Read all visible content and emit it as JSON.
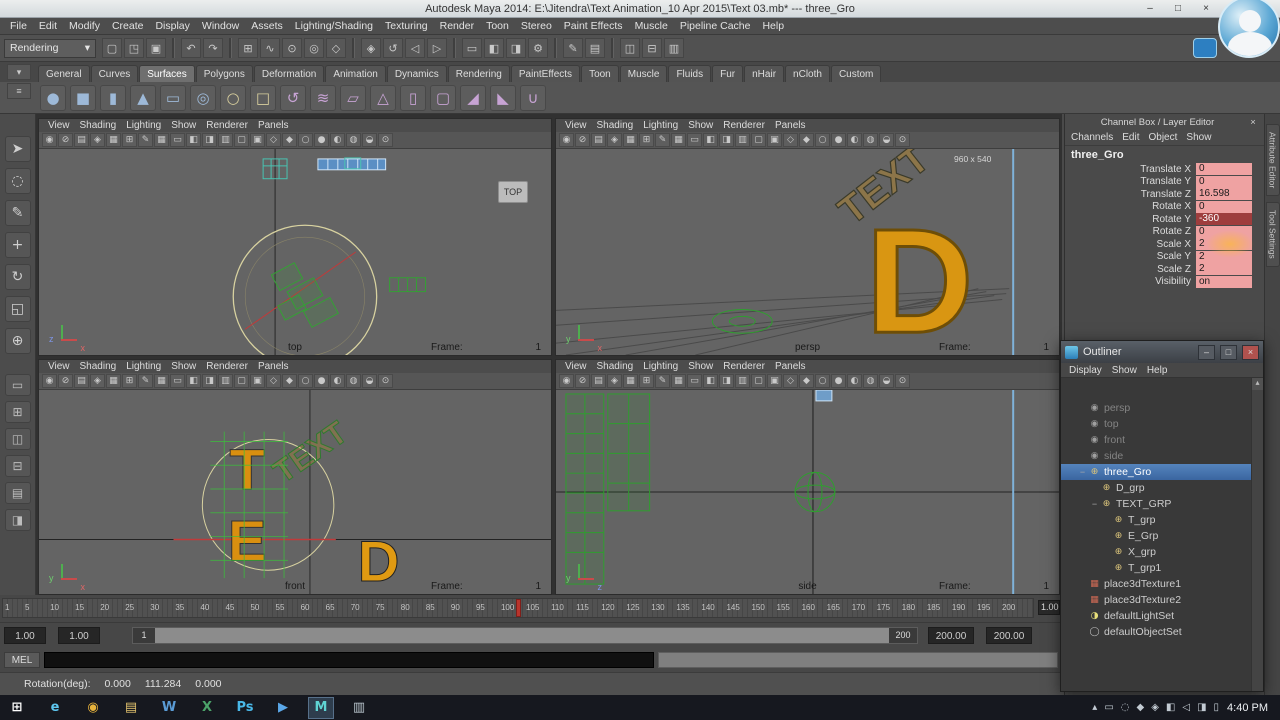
{
  "window": {
    "title": "Autodesk Maya 2014: E:\\Jitendra\\Text Animation_10 Apr 2015\\Text 03.mb*  ---  three_Gro",
    "minimize": "–",
    "maximize": "□",
    "close": "×"
  },
  "menu_bar": [
    "File",
    "Edit",
    "Modify",
    "Create",
    "Display",
    "Window",
    "Assets",
    "Lighting/Shading",
    "Texturing",
    "Render",
    "Toon",
    "Stereo",
    "Paint Effects",
    "Muscle",
    "Pipeline Cache",
    "Help"
  ],
  "status_line": {
    "menu_set": "Rendering",
    "caret": "▾",
    "icons": [
      {
        "name": "new-scene",
        "glyph": "▢"
      },
      {
        "name": "open-scene",
        "glyph": "◳"
      },
      {
        "name": "save-scene",
        "glyph": "▣"
      },
      {
        "name": "undo",
        "glyph": "↶"
      },
      {
        "name": "redo",
        "glyph": "↷"
      },
      {
        "name": "snap-to-grid",
        "glyph": "⊞"
      },
      {
        "name": "snap-to-curve",
        "glyph": "∿"
      },
      {
        "name": "snap-to-point",
        "glyph": "⊙"
      },
      {
        "name": "snap-to-projected-center",
        "glyph": "◎"
      },
      {
        "name": "snap-to-view-plane",
        "glyph": "◇"
      },
      {
        "name": "make-live",
        "glyph": "◈"
      },
      {
        "name": "construction-history",
        "glyph": "↺"
      },
      {
        "name": "list-input-connections",
        "glyph": "◁"
      },
      {
        "name": "list-output-connections",
        "glyph": "▷"
      },
      {
        "name": "open-render-view",
        "glyph": "▭"
      },
      {
        "name": "render-current-frame",
        "glyph": "◧"
      },
      {
        "name": "ipr-render",
        "glyph": "◨"
      },
      {
        "name": "render-settings",
        "glyph": "⚙"
      },
      {
        "name": "paint-effects-panel",
        "glyph": "✎"
      },
      {
        "name": "hypershade-panel",
        "glyph": "▤"
      },
      {
        "name": "show-attribute-editor",
        "glyph": "◫"
      },
      {
        "name": "show-tool-settings",
        "glyph": "⊟"
      },
      {
        "name": "show-channel-box",
        "glyph": "▥"
      }
    ]
  },
  "shelf": {
    "active_tab": "Surfaces",
    "tabs": [
      "General",
      "Curves",
      "Surfaces",
      "Polygons",
      "Deformation",
      "Animation",
      "Dynamics",
      "Rendering",
      "PaintEffects",
      "Toon",
      "Muscle",
      "Fluids",
      "Fur",
      "nHair",
      "nCloth",
      "Custom"
    ],
    "menu_buttons": [
      {
        "name": "shelf-tab-switcher",
        "glyph": "▾"
      },
      {
        "name": "shelf-menu",
        "glyph": "≡"
      }
    ],
    "tools": [
      {
        "name": "nurbs-sphere",
        "glyph": "●",
        "color": "#9db9d8"
      },
      {
        "name": "nurbs-cube",
        "glyph": "■",
        "color": "#9db9d8"
      },
      {
        "name": "nurbs-cylinder",
        "glyph": "▮",
        "color": "#9db9d8"
      },
      {
        "name": "nurbs-cone",
        "glyph": "▲",
        "color": "#9db9d8"
      },
      {
        "name": "nurbs-plane",
        "glyph": "▭",
        "color": "#9db9d8"
      },
      {
        "name": "nurbs-torus",
        "glyph": "◎",
        "color": "#9db9d8"
      },
      {
        "name": "nurbs-circle",
        "glyph": "○",
        "color": "#d8cf9d"
      },
      {
        "name": "nurbs-square",
        "glyph": "□",
        "color": "#d8cf9d"
      },
      {
        "name": "revolve",
        "glyph": "↺",
        "color": "#c7a3d4"
      },
      {
        "name": "loft",
        "glyph": "≋",
        "color": "#c7a3d4"
      },
      {
        "name": "planar",
        "glyph": "▱",
        "color": "#c7a3d4"
      },
      {
        "name": "extrude",
        "glyph": "△",
        "color": "#c7a3d4"
      },
      {
        "name": "birail",
        "glyph": "▯",
        "color": "#c7a3d4"
      },
      {
        "name": "boundary",
        "glyph": "▢",
        "color": "#c7a3d4"
      },
      {
        "name": "bevel",
        "glyph": "◢",
        "color": "#c7a3d4"
      },
      {
        "name": "bevel-plus",
        "glyph": "◣",
        "color": "#c7a3d4"
      },
      {
        "name": "attach-surfaces",
        "glyph": "∪",
        "color": "#c7a3d4"
      }
    ]
  },
  "toolbox": {
    "tools": [
      {
        "name": "select-tool",
        "glyph": "➤"
      },
      {
        "name": "lasso-select-tool",
        "glyph": "◌"
      },
      {
        "name": "paint-selection-tool",
        "glyph": "✎"
      },
      {
        "name": "move-tool",
        "glyph": "+"
      },
      {
        "name": "rotate-tool",
        "glyph": "↻"
      },
      {
        "name": "scale-tool",
        "glyph": "◱"
      },
      {
        "name": "universal-manipulator-tool",
        "glyph": "⊕"
      }
    ],
    "layouts": [
      {
        "name": "single-pane-layout",
        "glyph": "▭"
      },
      {
        "name": "four-pane-layout",
        "glyph": "⊞"
      },
      {
        "name": "persp-outliner-layout",
        "glyph": "◫"
      },
      {
        "name": "persp-graph-layout",
        "glyph": "⊟"
      },
      {
        "name": "hypershade-persp-layout",
        "glyph": "▤"
      },
      {
        "name": "persp-persp-layout",
        "glyph": "◨"
      }
    ]
  },
  "viewports": {
    "menu": [
      "View",
      "Shading",
      "Lighting",
      "Show",
      "Renderer",
      "Panels"
    ],
    "frame_label": "Frame:",
    "toolbar_icons": [
      {
        "name": "select-camera",
        "glyph": "◉"
      },
      {
        "name": "lock-camera",
        "glyph": "⊘"
      },
      {
        "name": "camera-attributes",
        "glyph": "▤"
      },
      {
        "name": "bookmark-view",
        "glyph": "◈"
      },
      {
        "name": "image-plane",
        "glyph": "▦"
      },
      {
        "name": "two-d-pan-zoom",
        "glyph": "⊞"
      },
      {
        "name": "grease-pencil",
        "glyph": "✎"
      },
      {
        "name": "grid-toggle",
        "glyph": "▦"
      },
      {
        "name": "film-gate",
        "glyph": "▭"
      },
      {
        "name": "resolution-gate",
        "glyph": "◧"
      },
      {
        "name": "gate-mask",
        "glyph": "◨"
      },
      {
        "name": "field-chart",
        "glyph": "▥"
      },
      {
        "name": "safe-action",
        "glyph": "▢"
      },
      {
        "name": "safe-title",
        "glyph": "▣"
      },
      {
        "name": "frame-all",
        "glyph": "◇"
      },
      {
        "name": "frame-selection",
        "glyph": "◆"
      },
      {
        "name": "wireframe-display",
        "glyph": "○"
      },
      {
        "name": "shaded-display",
        "glyph": "●"
      },
      {
        "name": "textured-display",
        "glyph": "◐"
      },
      {
        "name": "use-default-material",
        "glyph": "◍"
      },
      {
        "name": "xray-display",
        "glyph": "◒"
      },
      {
        "name": "isolate-select",
        "glyph": "⊙"
      }
    ],
    "top": {
      "label": "top",
      "frame": "1",
      "overlay": "TOP",
      "axis_v": "z",
      "axis_h": "x"
    },
    "persp": {
      "label": "persp",
      "frame": "1",
      "resolution": "960 x 540",
      "scene_d": "D",
      "scene_text": "TEXT",
      "axis_v": "y",
      "axis_h": "x"
    },
    "front": {
      "label": "front",
      "frame": "1",
      "scene_t": "T",
      "scene_e": "E",
      "scene_d": "D",
      "scene_text": "TEXT",
      "axis_v": "y",
      "axis_h": "x"
    },
    "side": {
      "label": "side",
      "frame": "1",
      "axis_v": "y",
      "axis_h": "z"
    }
  },
  "channel_box": {
    "header": "Channel Box / Layer Editor",
    "menus": [
      "Channels",
      "Edit",
      "Object",
      "Show"
    ],
    "object_name": "three_Gro",
    "attributes": [
      {
        "name": "Translate X",
        "value": "0"
      },
      {
        "name": "Translate Y",
        "value": "0"
      },
      {
        "name": "Translate Z",
        "value": "16.598"
      },
      {
        "name": "Rotate X",
        "value": "0"
      },
      {
        "name": "Rotate Y",
        "value": "-360",
        "selected": true
      },
      {
        "name": "Rotate Z",
        "value": "0"
      },
      {
        "name": "Scale X",
        "value": "2"
      },
      {
        "name": "Scale Y",
        "value": "2"
      },
      {
        "name": "Scale Z",
        "value": "2"
      },
      {
        "name": "Visibility",
        "value": "on"
      }
    ],
    "side_tabs": [
      "Attribute Editor",
      "Tool Settings"
    ]
  },
  "outliner": {
    "title": "Outliner",
    "menus": [
      "Display",
      "Show",
      "Help"
    ],
    "minimize": "–",
    "maximize": "□",
    "close": "×",
    "scroll_up": "▴",
    "items": [
      {
        "label": "persp",
        "icon": "camera-icon",
        "indent": 1,
        "muted": true
      },
      {
        "label": "top",
        "icon": "camera-icon",
        "indent": 1,
        "muted": true
      },
      {
        "label": "front",
        "icon": "camera-icon",
        "indent": 1,
        "muted": true
      },
      {
        "label": "side",
        "icon": "camera-icon",
        "indent": 1,
        "muted": true
      },
      {
        "label": "three_Gro",
        "icon": "transform-icon",
        "indent": 1,
        "selected": true,
        "toggle": "−"
      },
      {
        "label": "D_grp",
        "icon": "transform-icon",
        "indent": 2
      },
      {
        "label": "TEXT_GRP",
        "icon": "transform-icon",
        "indent": 2,
        "toggle": "−"
      },
      {
        "label": "T_grp",
        "icon": "transform-icon",
        "indent": 3
      },
      {
        "label": "E_Grp",
        "icon": "transform-icon",
        "indent": 3
      },
      {
        "label": "X_grp",
        "icon": "transform-icon",
        "indent": 3
      },
      {
        "label": "T_grp1",
        "icon": "transform-icon",
        "indent": 3
      },
      {
        "label": "place3dTexture1",
        "icon": "place3d-texture-icon",
        "indent": 1
      },
      {
        "label": "place3dTexture2",
        "icon": "place3d-texture-icon",
        "indent": 1
      },
      {
        "label": "defaultLightSet",
        "icon": "light-set-icon",
        "indent": 1
      },
      {
        "label": "defaultObjectSet",
        "icon": "object-set-icon",
        "indent": 1
      }
    ]
  },
  "timeline": {
    "tick_labels": [
      "1",
      "5",
      "10",
      "15",
      "20",
      "25",
      "30",
      "35",
      "40",
      "45",
      "50",
      "55",
      "60",
      "65",
      "70",
      "75",
      "80",
      "85",
      "90",
      "95",
      "100",
      "105",
      "110",
      "115",
      "120",
      "125",
      "130",
      "135",
      "140",
      "145",
      "150",
      "155",
      "160",
      "165",
      "170",
      "175",
      "180",
      "185",
      "190",
      "195",
      "200"
    ],
    "marker_frame": 103,
    "current_time": "1.00"
  },
  "range_slider": {
    "anim_start": "1.00",
    "playback_start": "1.00",
    "range_start": "1",
    "range_end": "200",
    "playback_end": "200.00",
    "anim_end": "200.00"
  },
  "command_line": {
    "label": "MEL"
  },
  "help_line": {
    "label": "Rotation(deg):",
    "values": [
      "0.000",
      "111.284",
      "0.000"
    ]
  },
  "taskbar": {
    "time": "4:40 PM",
    "apps": [
      {
        "name": "start-button",
        "glyph": "⊞",
        "color": "#ffffff"
      },
      {
        "name": "internet-explorer-icon",
        "glyph": "e",
        "color": "#5ec7f0"
      },
      {
        "name": "chrome-icon",
        "glyph": "◉",
        "color": "#e8b33c"
      },
      {
        "name": "file-explorer-icon",
        "glyph": "▤",
        "color": "#e3c36e"
      },
      {
        "name": "word-icon",
        "glyph": "W",
        "color": "#5a9bd5"
      },
      {
        "name": "excel-icon",
        "glyph": "X",
        "color": "#4ca36a"
      },
      {
        "name": "photoshop-icon",
        "glyph": "Ps",
        "color": "#49b8e8"
      },
      {
        "name": "media-player-icon",
        "glyph": "▶",
        "color": "#5aa7e8"
      },
      {
        "name": "maya-icon",
        "glyph": "M",
        "color": "#5fd3d3",
        "active": true
      },
      {
        "name": "notepad-icon",
        "glyph": "▥",
        "color": "#b9c4cc"
      }
    ],
    "tray": [
      {
        "name": "show-hidden-icons",
        "glyph": "▴"
      },
      {
        "name": "action-center-icon",
        "glyph": "▭"
      },
      {
        "name": "onedrive-icon",
        "glyph": "◌"
      },
      {
        "name": "antivirus-icon",
        "glyph": "◆"
      },
      {
        "name": "graphics-icon",
        "glyph": "◈"
      },
      {
        "name": "usb-icon",
        "glyph": "◧"
      },
      {
        "name": "volume-icon",
        "glyph": "◁"
      },
      {
        "name": "network-icon",
        "glyph": "◨"
      },
      {
        "name": "battery-icon",
        "glyph": "▯"
      }
    ]
  }
}
